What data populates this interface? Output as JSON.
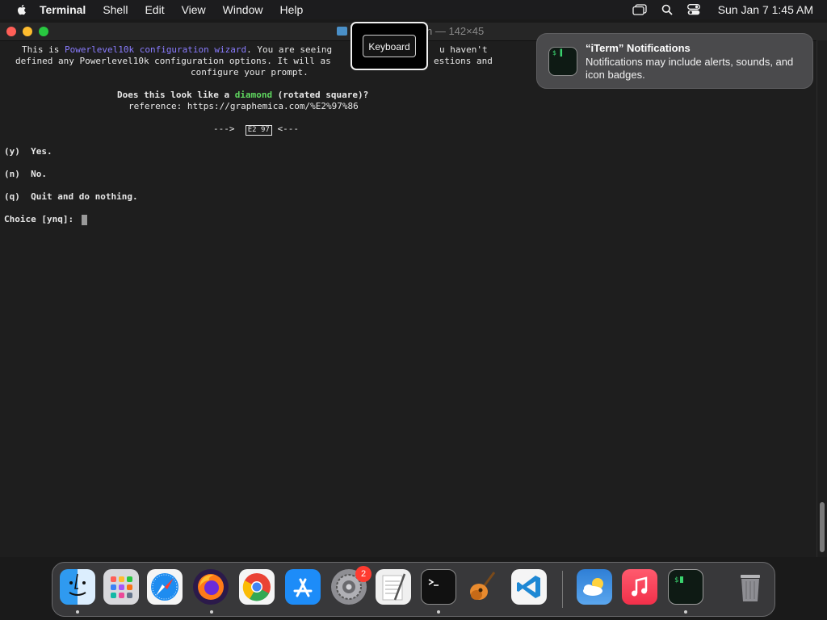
{
  "menubar": {
    "app_name": "Terminal",
    "items": [
      "Shell",
      "Edit",
      "View",
      "Window",
      "Help"
    ],
    "clock": "Sun Jan 7  1:45 AM"
  },
  "window": {
    "title": "n — 142×45"
  },
  "terminal": {
    "line1_a": "This is ",
    "line1_b": "Powerlevel10k configuration wizard",
    "line1_c": ". You are seeing",
    "line1_d": "u haven't",
    "line2_a": "defined any Powerlevel10k configuration options. It will as",
    "line2_b": "estions and",
    "line3": "configure your prompt.",
    "question_a": "Does this look like a ",
    "question_b": "diamond",
    "question_c": " (rotated square)?",
    "reference": "reference: https://graphemica.com/%E2%97%86",
    "arrow_left": "--->",
    "glyph": "E2 97",
    "arrow_right": "<---",
    "option_y": "(y)  Yes.",
    "option_n": "(n)  No.",
    "option_q": "(q)  Quit and do nothing.",
    "prompt": "Choice [ynq]: "
  },
  "overlay": {
    "keyboard_label": "Keyboard"
  },
  "notification": {
    "title": "“iTerm” Notifications",
    "body": "Notifications may include alerts, sounds, and icon badges.",
    "icon_text": "$ ▌"
  },
  "dock": {
    "apps": [
      "Finder",
      "Launchpad",
      "Safari",
      "Firefox",
      "Chrome",
      "App Store",
      "System Settings",
      "TextEdit",
      "Terminal",
      "GarageBand",
      "Visual Studio Code",
      "Weather",
      "Music",
      "iTerm",
      "Trash"
    ],
    "settings_badge": "2"
  },
  "colors": {
    "accent_purple": "#8a7cff",
    "accent_green": "#5fd75f"
  }
}
